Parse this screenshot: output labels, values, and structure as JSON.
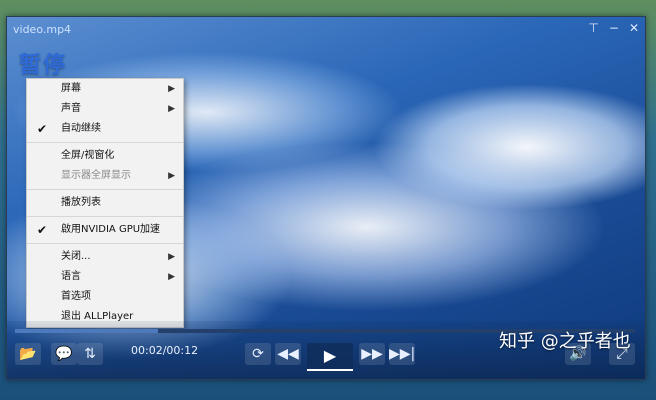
{
  "player": {
    "title": "video.mp4",
    "overlay_text": "暂停",
    "time": "00:02/00:12",
    "progress": 0.23
  },
  "window_controls": {
    "pin": "⊤",
    "min": "−",
    "close": "✕"
  },
  "context_menu": {
    "items": [
      {
        "label": "屏幕",
        "submenu": true
      },
      {
        "label": "声音",
        "submenu": true
      },
      {
        "label": "自动继续",
        "checked": true
      },
      {
        "label": "全屏/视窗化"
      },
      {
        "label": "显示器全屏显示",
        "disabled": true,
        "submenu": true
      },
      {
        "label": "播放列表"
      },
      {
        "label": "啟用NVIDIA GPU加速",
        "checked": true
      },
      {
        "label": "关闭...",
        "submenu": true
      },
      {
        "label": "语言",
        "submenu": true
      },
      {
        "label": "首选项"
      },
      {
        "label": "退出 ALLPlayer"
      }
    ]
  },
  "watermark": "知乎 @之乎者也",
  "icons": {
    "folder": "📂",
    "subtitles": "💬",
    "equalizer": "⇅",
    "repeat": "⟳",
    "rewind": "◀◀",
    "play": "▶",
    "fast_forward": "▶▶",
    "skip": "▶▶|",
    "volume": "🔊",
    "fullscreen": "⤢"
  }
}
